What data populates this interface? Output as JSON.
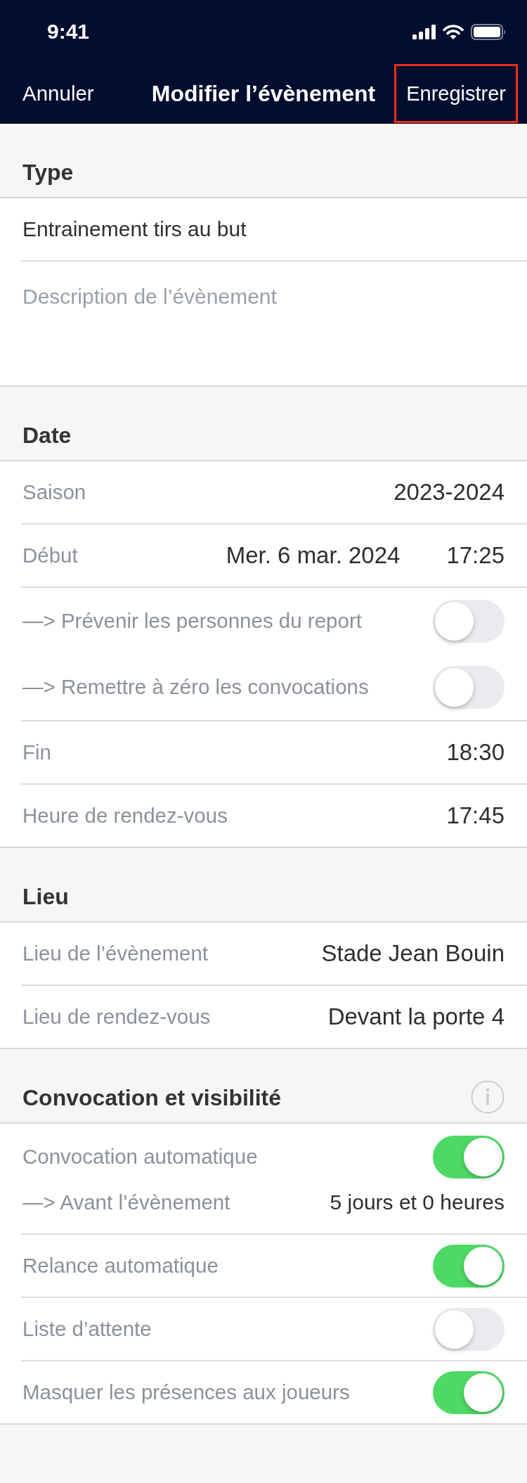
{
  "status_bar": {
    "time": "9:41"
  },
  "nav_bar": {
    "cancel": "Annuler",
    "title": "Modifier l’évènement",
    "save": {
      "label": "Enregistrer",
      "highlighted": true
    }
  },
  "sections": [
    {
      "title": "Type",
      "info_button": false,
      "groups": [
        {
          "rows": [
            {
              "kind": "text_field",
              "value": "Entrainement tirs au but"
            }
          ]
        },
        {
          "rows": [
            {
              "kind": "text_area",
              "placeholder": "Description de l’évènement"
            }
          ]
        }
      ]
    },
    {
      "title": "Date",
      "info_button": false,
      "groups": [
        {
          "rows": [
            {
              "kind": "value",
              "label": "Saison",
              "value": "2023-2024"
            }
          ]
        },
        {
          "rows": [
            {
              "kind": "date_time",
              "label": "Début",
              "date": "Mer. 6 mar. 2024",
              "time": "17:25"
            }
          ]
        },
        {
          "rows": [
            {
              "kind": "toggle",
              "label": "—> Prévenir les personnes du report",
              "on": false
            },
            {
              "kind": "toggle",
              "label": "—> Remettre à zéro les convocations",
              "on": false
            }
          ]
        },
        {
          "rows": [
            {
              "kind": "value",
              "label": "Fin",
              "value": "18:30"
            }
          ]
        },
        {
          "rows": [
            {
              "kind": "value",
              "label": "Heure de rendez-vous",
              "value": "17:45"
            }
          ]
        }
      ]
    },
    {
      "title": "Lieu",
      "info_button": false,
      "groups": [
        {
          "rows": [
            {
              "kind": "value",
              "label": "Lieu de l’évènement",
              "value": "Stade Jean Bouin"
            }
          ]
        },
        {
          "rows": [
            {
              "kind": "value",
              "label": "Lieu de rendez-vous",
              "value": "Devant la porte 4"
            }
          ]
        }
      ]
    },
    {
      "title": "Convocation et visibilité",
      "info_button": true,
      "groups": [
        {
          "rows": [
            {
              "kind": "toggle",
              "label": "Convocation automatique",
              "on": true
            },
            {
              "kind": "value",
              "label": "—> Avant l’évènement",
              "value": "5 jours et 0 heures"
            }
          ]
        },
        {
          "rows": [
            {
              "kind": "toggle",
              "label": "Relance automatique",
              "on": true
            }
          ]
        },
        {
          "rows": [
            {
              "kind": "toggle",
              "label": "Liste d’attente",
              "on": false
            }
          ]
        },
        {
          "rows": [
            {
              "kind": "toggle",
              "label": "Masquer les présences aux joueurs",
              "on": true
            }
          ]
        }
      ]
    }
  ]
}
